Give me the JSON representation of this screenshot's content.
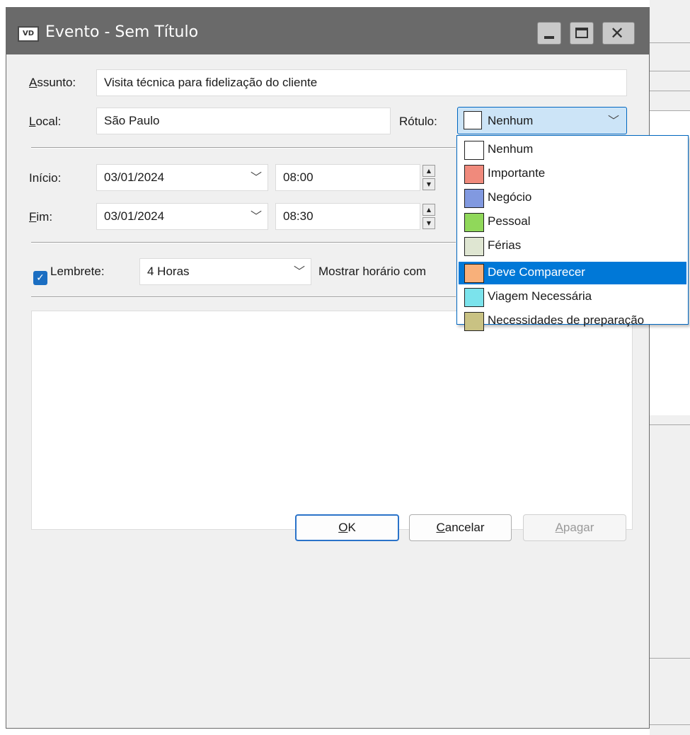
{
  "window": {
    "icon_text": "VD",
    "title": "Evento - Sem Título"
  },
  "form": {
    "assunto_label": "ssunto:",
    "assunto_label_key": "A",
    "assunto_value": "Visita técnica para fidelização do cliente",
    "local_label": "ocal:",
    "local_label_key": "L",
    "local_value": "São Paulo",
    "rotulo_label": "Rótulo:",
    "rotulo_value": "Nenhum",
    "inicio_label": "Início:",
    "inicio_date": "03/01/2024",
    "inicio_time": "08:00",
    "fim_label": "im:",
    "fim_label_key": "F",
    "fim_date": "03/01/2024",
    "fim_time": "08:30",
    "lembrete_checked": true,
    "lembrete_label": "Lembrete:",
    "lembrete_value": "4 Horas",
    "mostrar_label": "Mostrar horário com"
  },
  "buttons": {
    "ok": "K",
    "ok_key": "O",
    "cancelar": "ancelar",
    "cancelar_key": "C",
    "apagar": "pagar",
    "apagar_key": "A"
  },
  "rotulo_options": [
    {
      "label": "Nenhum",
      "color": "#ffffff",
      "selected": false
    },
    {
      "label": "Importante",
      "color": "#f08a7c",
      "selected": false
    },
    {
      "label": "Negócio",
      "color": "#8199e0",
      "selected": false
    },
    {
      "label": "Pessoal",
      "color": "#90d85a",
      "selected": false
    },
    {
      "label": "Férias",
      "color": "#dfe6d2",
      "selected": false
    },
    {
      "label": "Deve Comparecer",
      "color": "#f8b07a",
      "selected": true
    },
    {
      "label": "Viagem Necessária",
      "color": "#7be3ec",
      "selected": false
    },
    {
      "label": "Necessidades de preparação",
      "color": "#c9c283",
      "selected": false
    }
  ],
  "colors": {
    "titlebar": "#6a6a6a",
    "accent": "#0078d7",
    "dialog_bg": "#f0f0f0"
  }
}
